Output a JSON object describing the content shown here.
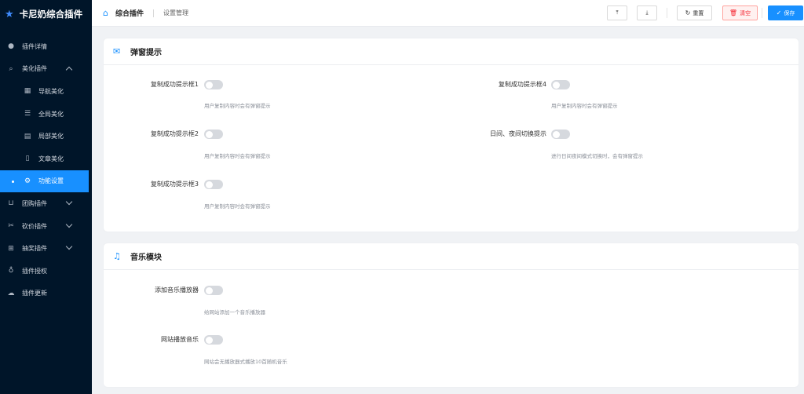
{
  "app": {
    "title": "卡尼奶综合插件"
  },
  "sidebar": {
    "items": [
      {
        "label": "插件详情",
        "icon": "info-icon"
      },
      {
        "label": "美化插件",
        "icon": "search-icon",
        "expanded": true
      },
      {
        "label": "导航美化",
        "icon": "grid-icon"
      },
      {
        "label": "全局美化",
        "icon": "sliders-icon"
      },
      {
        "label": "局部美化",
        "icon": "table-icon"
      },
      {
        "label": "文章美化",
        "icon": "document-icon"
      },
      {
        "label": "功能设置",
        "icon": "gear-icon",
        "active": true
      },
      {
        "label": "团购插件",
        "icon": "cart-icon"
      },
      {
        "label": "砍价插件",
        "icon": "scissors-icon"
      },
      {
        "label": "抽奖插件",
        "icon": "gift-icon"
      },
      {
        "label": "插件授权",
        "icon": "key-icon"
      },
      {
        "label": "插件更新",
        "icon": "cloud-icon"
      }
    ]
  },
  "header": {
    "breadcrumb_main": "综合插件",
    "breadcrumb_sub": "设置管理",
    "reset_label": "重置",
    "clear_label": "清空",
    "save_label": "保存"
  },
  "colors": {
    "accent": "#1890ff",
    "sidebar_bg": "#001529",
    "danger": "#f5222d"
  },
  "popup_section": {
    "title": "弹窗提示",
    "fields": [
      {
        "label": "复制成功提示框1",
        "hint": "用户复制内容时会有弹窗提示",
        "enabled": false
      },
      {
        "label": "复制成功提示框2",
        "hint": "用户复制内容时会有弹窗提示",
        "enabled": false
      },
      {
        "label": "复制成功提示框3",
        "hint": "用户复制内容时会有弹窗提示",
        "enabled": false
      },
      {
        "label": "复制成功提示框4",
        "hint": "用户复制内容时会有弹窗提示",
        "enabled": false
      },
      {
        "label": "日间、夜间切换提示",
        "hint": "进行日间夜间模式切换时，会有弹窗提示",
        "enabled": false
      }
    ]
  },
  "music_section": {
    "title": "音乐模块",
    "fields": [
      {
        "label": "添加音乐播放器",
        "hint": "给网站添加一个音乐播放器",
        "enabled": false
      },
      {
        "label": "网站播放音乐",
        "hint": "网站会无播放器式播放10首随机音乐",
        "enabled": false
      }
    ]
  }
}
